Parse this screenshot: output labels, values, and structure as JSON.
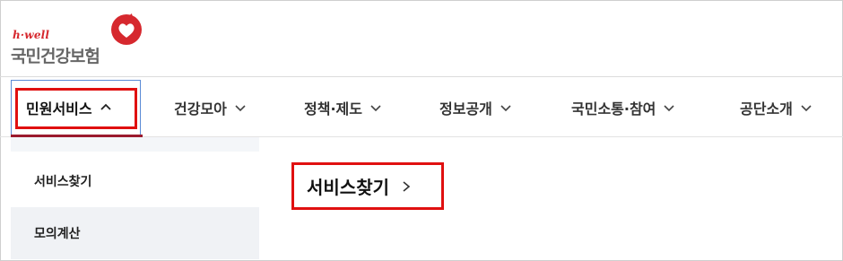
{
  "brand": {
    "tagline": "h·well",
    "name": "국민건강보험",
    "colors": {
      "primary": "#d6282e",
      "accent": "#9b1b2e",
      "highlight": "#e01010"
    }
  },
  "gnb": {
    "items": [
      {
        "label": "민원서비스",
        "icon": "chevron-up-icon",
        "active": true
      },
      {
        "label": "건강모아",
        "icon": "chevron-down-icon"
      },
      {
        "label": "정책·제도",
        "icon": "chevron-down-icon"
      },
      {
        "label": "정보공개",
        "icon": "chevron-down-icon"
      },
      {
        "label": "국민소통·참여",
        "icon": "chevron-down-icon"
      },
      {
        "label": "공단소개",
        "icon": "chevron-down-icon"
      }
    ]
  },
  "submenu": {
    "items": [
      {
        "label": ""
      },
      {
        "label": "서비스찾기"
      },
      {
        "label": "모의계산"
      }
    ]
  },
  "content": {
    "title": "서비스찾기",
    "icon": "chevron-right-icon"
  }
}
